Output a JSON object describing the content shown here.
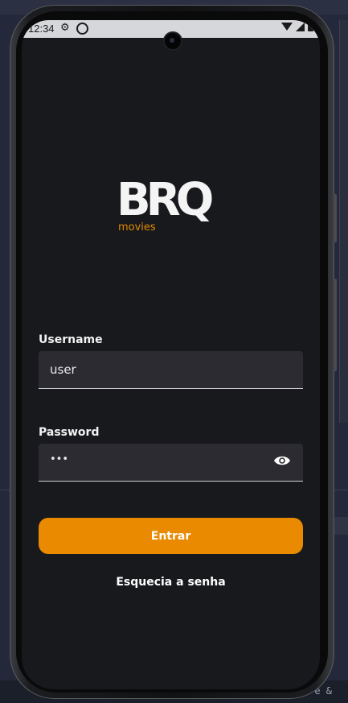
{
  "status_bar": {
    "time": "12:34",
    "icons": [
      "gear-icon",
      "sync-icon",
      "wifi-icon",
      "signal-icon",
      "battery-icon"
    ]
  },
  "logo": {
    "brand": "BRQ",
    "subtitle": "movies",
    "colors": {
      "letters": "#f4f4f4",
      "subtitle": "#e28800"
    }
  },
  "form": {
    "username": {
      "label": "Username",
      "value": "user"
    },
    "password": {
      "label": "Password",
      "value": "•••",
      "toggle_icon": "eye-icon"
    }
  },
  "actions": {
    "login_label": "Entrar",
    "forgot_label": "Esquecia a senha"
  },
  "background": {
    "bottom_text": "e  &"
  },
  "theme": {
    "accent": "#e98a00",
    "screen_bg": "#18191d",
    "field_bg": "#2b2b31"
  }
}
